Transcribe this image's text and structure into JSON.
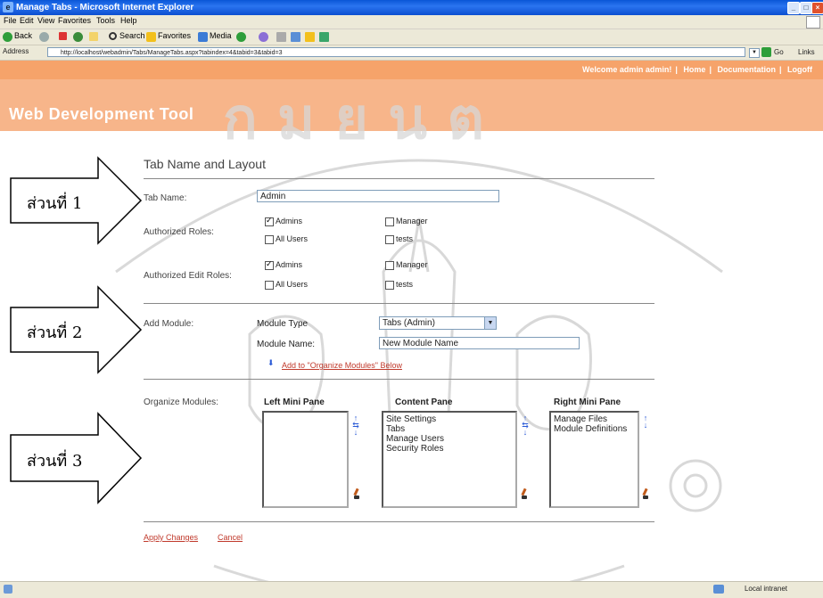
{
  "window": {
    "title": "Manage Tabs - Microsoft Internet Explorer",
    "buttons": [
      "_",
      "□",
      "×"
    ]
  },
  "menu": [
    "File",
    "Edit",
    "View",
    "Favorites",
    "Tools",
    "Help"
  ],
  "toolbar": {
    "back": "Back",
    "search": "Search",
    "favorites": "Favorites",
    "media": "Media"
  },
  "address": {
    "label": "Address",
    "url": "http://localhost/webadmin/Tabs/ManageTabs.aspx?tabindex=4&tabid=3&tabid=3",
    "go": "Go",
    "links": "Links"
  },
  "site": {
    "welcome": "Welcome admin admin!",
    "nav": [
      "Home",
      "Documentation",
      "Logoff"
    ],
    "title": "Web Development Tool"
  },
  "form": {
    "heading": "Tab Name and Layout",
    "tab_name_label": "Tab Name:",
    "tab_name_value": "Admin",
    "auth_roles_label": "Authorized Roles:",
    "auth_roles": [
      {
        "label": "Admins",
        "checked": true
      },
      {
        "label": "Manager",
        "checked": false
      },
      {
        "label": "All Users",
        "checked": false
      },
      {
        "label": "tests",
        "checked": false
      }
    ],
    "edit_roles_label": "Authorized Edit Roles:",
    "edit_roles": [
      {
        "label": "Admins",
        "checked": true
      },
      {
        "label": "Manager",
        "checked": false
      },
      {
        "label": "All Users",
        "checked": false
      },
      {
        "label": "tests",
        "checked": false
      }
    ],
    "add_module_label": "Add Module:",
    "module_type_label": "Module Type",
    "module_type_value": "Tabs (Admin)",
    "module_name_label": "Module Name:",
    "module_name_value": "New Module Name",
    "add_link": "Add to \"Organize Modules\" Below",
    "organize_label": "Organize Modules:",
    "panes": [
      {
        "title": "Left Mini Pane",
        "items": []
      },
      {
        "title": "Content Pane",
        "items": [
          "Site Settings",
          "Tabs",
          "Manage Users",
          "Security Roles"
        ]
      },
      {
        "title": "Right Mini Pane",
        "items": [
          "Manage Files",
          "Module Definitions"
        ]
      }
    ],
    "apply": "Apply Changes",
    "cancel": "Cancel"
  },
  "callouts": [
    "ส่วนที่ 1",
    "ส่วนที่ 2",
    "ส่วนที่ 3"
  ],
  "status": {
    "zone": "Local intranet"
  },
  "colors": {
    "header_top": "#f6a36a",
    "header_band": "#f7b58a",
    "link_red": "#c0392b",
    "title_blue": "#0a56d6"
  }
}
